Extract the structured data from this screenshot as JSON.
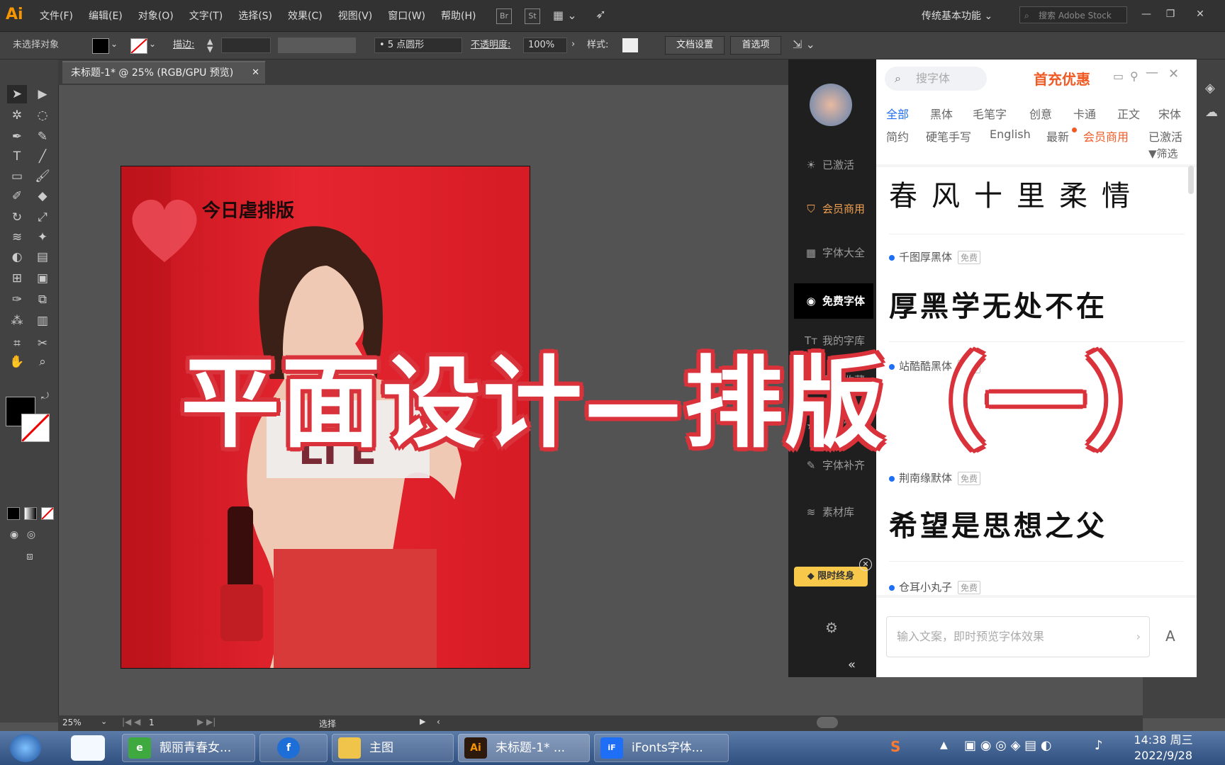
{
  "app": {
    "logo": "Ai",
    "menus": [
      "文件(F)",
      "编辑(E)",
      "对象(O)",
      "文字(T)",
      "选择(S)",
      "效果(C)",
      "视图(V)",
      "窗口(W)",
      "帮助(H)"
    ],
    "bridge_label": "Br",
    "stock_label": "St",
    "workspace": "传统基本功能",
    "stock_placeholder": "搜索 Adobe Stock"
  },
  "control_bar": {
    "selection": "未选择对象",
    "stroke_label": "描边:",
    "brush": "5 点圆形",
    "opacity_label": "不透明度:",
    "opacity_value": "100%",
    "style_label": "样式:",
    "doc_setup": "文档设置",
    "preferences": "首选项"
  },
  "document": {
    "tab_title": "未标题-1* @ 25% (RGB/GPU 预览)",
    "artboard_heading": "今日虐排版"
  },
  "status": {
    "zoom": "25%",
    "page": "1",
    "mode": "选择"
  },
  "overlay": {
    "title": "平面设计—排版（一）"
  },
  "font_plugin": {
    "sidebar": [
      {
        "label": "已激活",
        "icon": "bulb-icon"
      },
      {
        "label": "会员商用",
        "icon": "shield-icon",
        "highlight": "#f0a050"
      },
      {
        "label": "字体大全",
        "icon": "grid-icon"
      },
      {
        "label": "免费字体",
        "icon": "free-icon",
        "active": true
      },
      {
        "label": "我的字库",
        "icon": "tt-icon"
      },
      {
        "label": "我的收藏",
        "icon": "folder-icon"
      },
      {
        "label": "我的字库",
        "icon": "star-icon"
      },
      {
        "label": "字体补齐",
        "icon": "wrench-icon"
      },
      {
        "label": "素材库",
        "icon": "layers-icon"
      }
    ],
    "badge": "限时终身",
    "search_placeholder": "搜字体",
    "promo": "首充优惠",
    "categories_row1": [
      "全部",
      "黑体",
      "毛笔字",
      "创意",
      "卡通",
      "正文",
      "宋体"
    ],
    "categories_row2": [
      "简约",
      "硬笔手写",
      "English",
      "最新",
      "会员商用",
      "已激活"
    ],
    "filter": "筛选",
    "fonts": [
      {
        "name": "",
        "tag": "",
        "preview": "春风十里柔情"
      },
      {
        "name": "千图厚黑体",
        "tag": "免费",
        "preview": "厚黑学无处不在"
      },
      {
        "name": "站酷酷黑体",
        "tag": "免费",
        "preview": ""
      },
      {
        "name": "荆南缘默体",
        "tag": "免费",
        "preview": "希望是思想之父"
      },
      {
        "name": "仓耳小丸子",
        "tag": "免费",
        "preview": ""
      }
    ],
    "input_placeholder": "输入文案，即时预览字体效果",
    "input_font_button": "A"
  },
  "taskbar": {
    "items": [
      {
        "label": "靓丽青春女...",
        "icon": "ie-icon"
      },
      {
        "label": "",
        "icon": "flash-icon"
      },
      {
        "label": "主图",
        "icon": "folder-icon"
      },
      {
        "label": "未标题-1* ...",
        "icon": "ai-icon"
      },
      {
        "label": "iFonts字体...",
        "icon": "ifonts-icon"
      }
    ],
    "time": "14:38 周三",
    "date": "2022/9/28"
  },
  "colors": {
    "accent_orange": "#f79500",
    "poster_red": "#e31d28",
    "plugin_blue": "#1e6ff5",
    "plugin_promo": "#f05a24"
  }
}
